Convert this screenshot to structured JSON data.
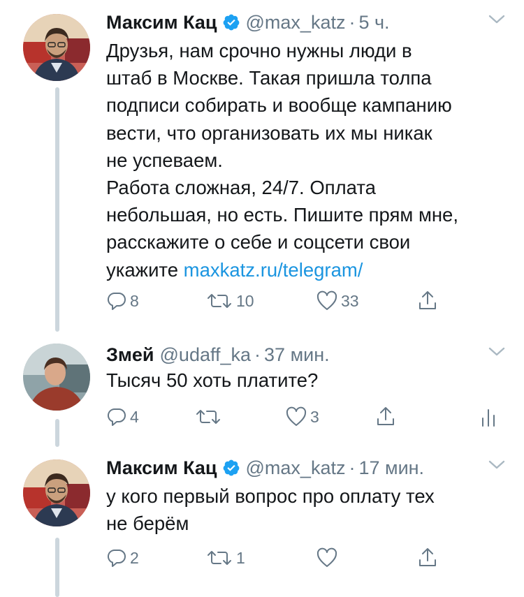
{
  "tweets": [
    {
      "name": "Максим Кац",
      "handle": "@max_katz",
      "separator": "·",
      "time": "5 ч.",
      "lines": [
        "Друзья, нам срочно нужны люди в",
        "штаб в Москве. Такая пришла толпа",
        "подписи собирать и вообще кампанию",
        "вести, что организовать их мы никак",
        "не успеваем.",
        "Работа сложная, 24/7. Оплата",
        "небольшая, но есть. Пишите прям мне,",
        "расскажите о себе и соцсети свои"
      ],
      "last_line_text": "укажите",
      "link": "maxkatz.ru/telegram/",
      "replies": "8",
      "retweets": "10",
      "likes": "33"
    },
    {
      "name": "Змей",
      "handle": "@udaff_ka",
      "separator": "·",
      "time": "37 мин.",
      "lines": [
        "Тысяч 50 хоть платите?"
      ],
      "replies": "4",
      "retweets": "",
      "likes": "3"
    },
    {
      "name": "Максим Кац",
      "handle": "@max_katz",
      "separator": "·",
      "time": "17 мин.",
      "lines": [
        "у кого первый вопрос про оплату тех",
        "не берём"
      ],
      "replies": "2",
      "retweets": "1",
      "likes": ""
    }
  ],
  "icons": {
    "verified": "verified-badge-icon",
    "caret": "chevron-down-icon",
    "reply": "reply-icon",
    "retweet": "retweet-icon",
    "like": "heart-icon",
    "share": "share-icon",
    "analytics": "analytics-icon"
  },
  "colors": {
    "accent": "#1da1f2",
    "link": "#1b95e0",
    "secondary_text": "#657786",
    "thread_line": "#ccd6dd"
  }
}
